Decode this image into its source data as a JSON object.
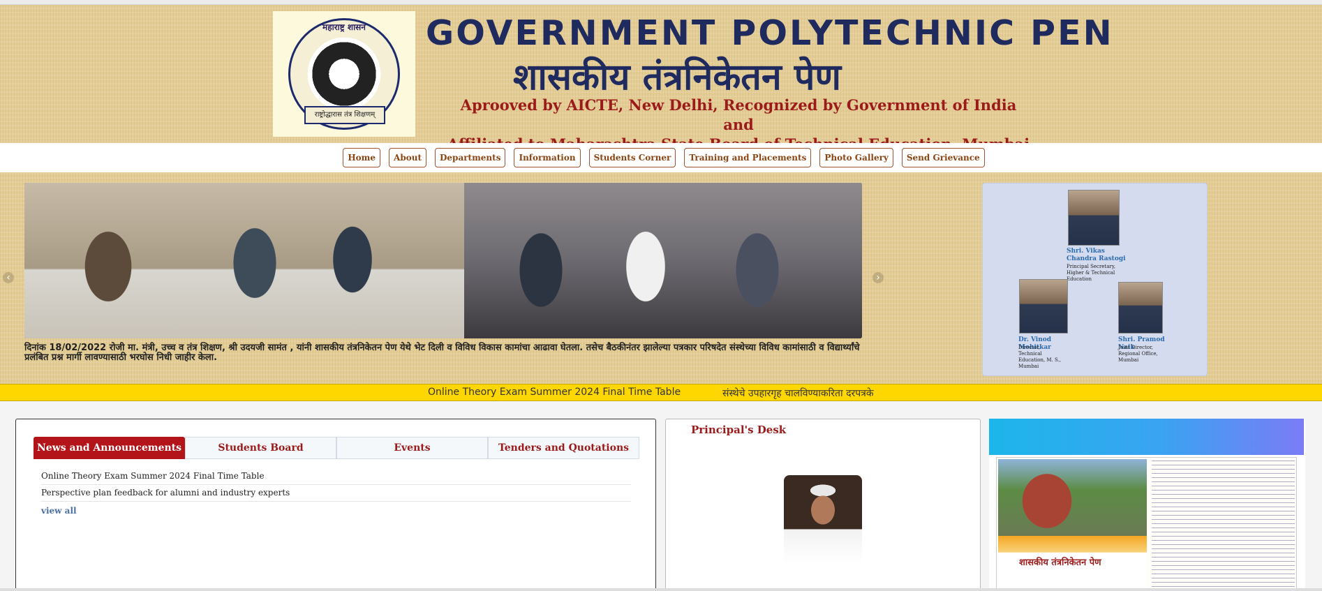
{
  "header": {
    "logo_text_top": "महाराष्ट्र शासन",
    "logo_text_bottom": "राष्ट्रोद्धारास तंत्र शिक्षणम्",
    "title_en": "GOVERNMENT POLYTECHNIC PEN",
    "title_mr": "शासकीय तंत्रनिकेतन पेण",
    "approval_line1": "Aprooved by AICTE, New Delhi, Recognized by Government of India and",
    "approval_line2": "Affiliated to Maharashtra State Board of Technical Education, Mumbai"
  },
  "nav": {
    "items": [
      "Home",
      "About",
      "Departments",
      "Information",
      "Students Corner",
      "Training and Placements",
      "Photo Gallery",
      "Send Grievance"
    ]
  },
  "slider": {
    "prev_icon": "‹",
    "next_icon": "›",
    "caption": "दिनांक 18/02/2022 रोजी मा. मंत्री, उच्च व तंत्र शिक्षण, श्री उदयजी सामंत , यांनी शासकीय तंत्रनिकेतन पेण येथे भेट दिली व विविध विकास कामांचा आढावा घेतला. तसेच बैठकीनंतर झालेल्या पत्रकार परिषदेत संस्थेच्या विविध कामांसाठी व विद्यार्थ्यांचे प्रलंबित प्रश्न मार्गी लावण्यासाठी भरघोस निधी जाहीर केला."
  },
  "officials": [
    {
      "name": "Shri. Vikas Chandra Rastogi",
      "role": "Principal Secretary, Higher & Technical Education"
    },
    {
      "name": "Dr. Vinod Mohitkar",
      "role": "Director, Technical Education, M. S., Mumbai"
    },
    {
      "name": "Shri. Pramod Naik",
      "role": "Joint Director, Regional Office, Mumbai"
    }
  ],
  "ticker": {
    "items": [
      "Online Theory Exam Summer 2024 Final Time Table",
      "संस्थेचे उपहारगृह चालविण्याकरिता दरपत्रके"
    ]
  },
  "news_panel": {
    "tabs": [
      "News and Announcements",
      "Students Board",
      "Events",
      "Tenders and Quotations"
    ],
    "active_tab": 0,
    "items": [
      "Online Theory Exam Summer 2024 Final Time Table",
      "Perspective plan feedback for alumni and industry experts"
    ],
    "view_all": "view all"
  },
  "principal_desk": {
    "title": "Principal's Desk"
  },
  "brochure": {
    "title": "शासकीय तंत्रनिकेतन पेण"
  }
}
